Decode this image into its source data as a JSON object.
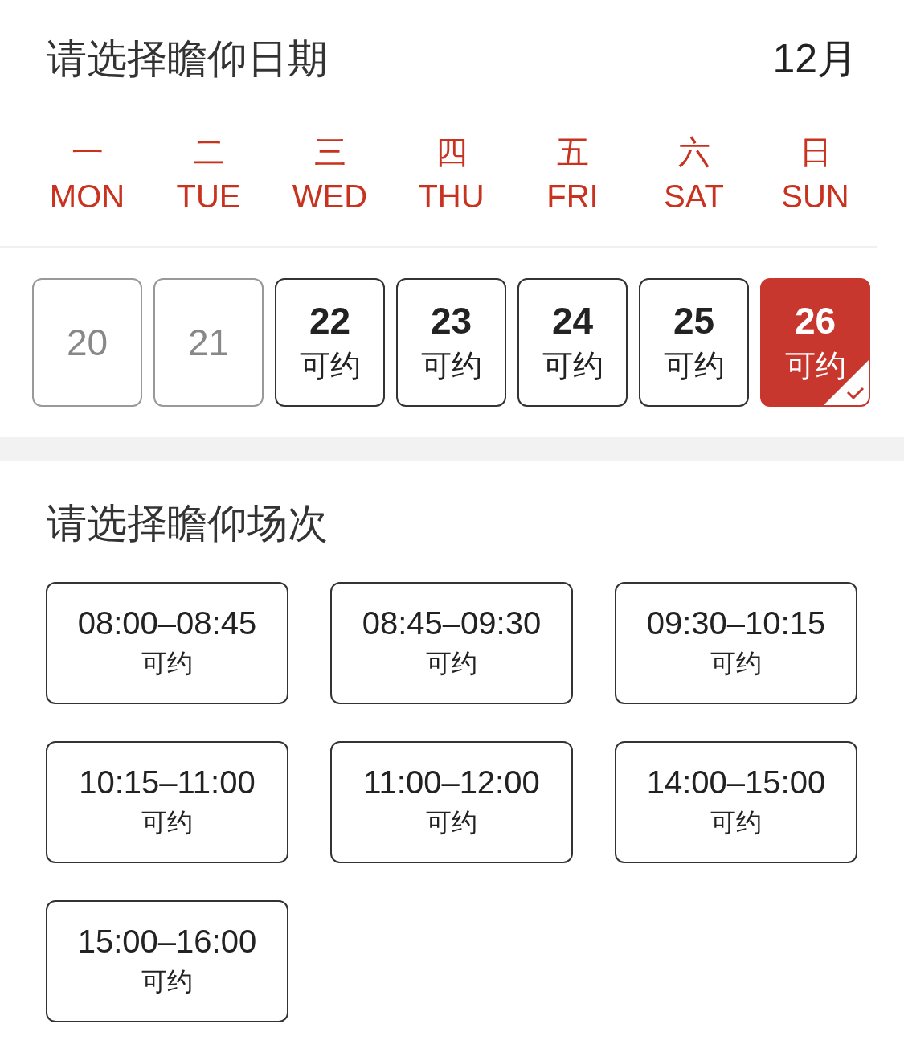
{
  "date_section": {
    "title": "请选择瞻仰日期",
    "month": "12月"
  },
  "weekdays": [
    {
      "zh": "一",
      "en": "MON"
    },
    {
      "zh": "二",
      "en": "TUE"
    },
    {
      "zh": "三",
      "en": "WED"
    },
    {
      "zh": "四",
      "en": "THU"
    },
    {
      "zh": "五",
      "en": "FRI"
    },
    {
      "zh": "六",
      "en": "SAT"
    },
    {
      "zh": "日",
      "en": "SUN"
    }
  ],
  "dates": [
    {
      "day": "20",
      "disabled": true,
      "selected": false
    },
    {
      "day": "21",
      "disabled": true,
      "selected": false
    },
    {
      "day": "22",
      "status": "可约",
      "disabled": false,
      "selected": false
    },
    {
      "day": "23",
      "status": "可约",
      "disabled": false,
      "selected": false
    },
    {
      "day": "24",
      "status": "可约",
      "disabled": false,
      "selected": false
    },
    {
      "day": "25",
      "status": "可约",
      "disabled": false,
      "selected": false
    },
    {
      "day": "26",
      "status": "可约",
      "disabled": false,
      "selected": true
    }
  ],
  "session_section": {
    "title": "请选择瞻仰场次"
  },
  "sessions": [
    {
      "time": "08:00–08:45",
      "status": "可约",
      "selected": false
    },
    {
      "time": "08:45–09:30",
      "status": "可约",
      "selected": false
    },
    {
      "time": "09:30–10:15",
      "status": "可约",
      "selected": false
    },
    {
      "time": "10:15–11:00",
      "status": "可约",
      "selected": false
    },
    {
      "time": "11:00–12:00",
      "status": "可约",
      "selected": false
    },
    {
      "time": "14:00–15:00",
      "status": "可约",
      "selected": false
    },
    {
      "time": "15:00–16:00",
      "status": "可约",
      "selected": false
    }
  ]
}
